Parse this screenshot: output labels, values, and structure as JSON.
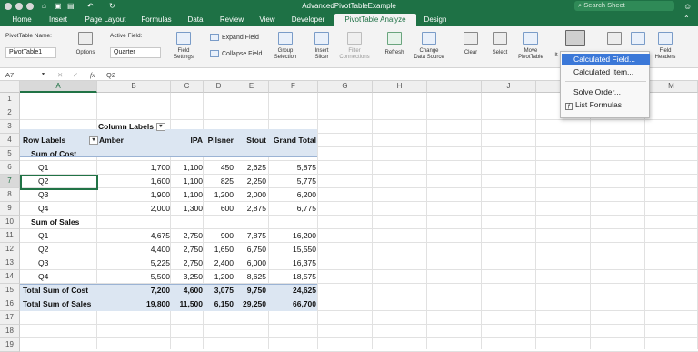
{
  "window": {
    "title": "AdvancedPivotTableExample",
    "search_placeholder": "Search Sheet"
  },
  "tabs": [
    "Home",
    "Insert",
    "Page Layout",
    "Formulas",
    "Data",
    "Review",
    "View",
    "Developer",
    "PivotTable Analyze",
    "Design"
  ],
  "ribbon": {
    "pivot_name_label": "PivotTable Name:",
    "pivot_name_value": "PivotTable1",
    "options": "Options",
    "active_field_label": "Active Field:",
    "active_field_value": "Quarter",
    "field_settings": [
      "Field",
      "Settings"
    ],
    "expand_field": "Expand Field",
    "collapse_field": "Collapse Field",
    "group_selection": [
      "Group",
      "Selection"
    ],
    "insert_slicer": [
      "Insert",
      "Slicer"
    ],
    "filter_connections": [
      "Filter",
      "Connections"
    ],
    "refresh": "Refresh",
    "change_data_source": [
      "Change",
      "Data Source"
    ],
    "clear": "Clear",
    "select": "Select",
    "move_pivottable": [
      "Move",
      "PivotTable"
    ],
    "fields_items_sets_partial": "It",
    "field_headers": [
      "Field",
      "Headers"
    ]
  },
  "formula_bar": {
    "name_box": "A7",
    "fx": "fx",
    "content": "Q2"
  },
  "menu": {
    "items": [
      "Calculated Field...",
      "Calculated Item...",
      "Solve Order...",
      "List Formulas"
    ]
  },
  "sheet": {
    "columns": [
      "A",
      "B",
      "C",
      "D",
      "E",
      "F",
      "G",
      "H",
      "I",
      "J",
      "K",
      "L",
      "M"
    ],
    "rows": [
      "1",
      "2",
      "3",
      "4",
      "5",
      "6",
      "7",
      "8",
      "9",
      "10",
      "11",
      "12",
      "13",
      "14",
      "15",
      "16",
      "17",
      "18",
      "19"
    ],
    "pivot": {
      "column_labels": "Column Labels",
      "row_labels": "Row Labels",
      "headers": [
        "Amber",
        "IPA",
        "Pilsner",
        "Stout",
        "Grand Total"
      ],
      "rows": [
        {
          "label": "Sum of Cost",
          "values": [
            "",
            "",
            "",
            "",
            ""
          ]
        },
        {
          "label": "Q1",
          "values": [
            "1,700",
            "1,100",
            "450",
            "2,625",
            "5,875"
          ]
        },
        {
          "label": "Q2",
          "values": [
            "1,600",
            "1,100",
            "825",
            "2,250",
            "5,775"
          ]
        },
        {
          "label": "Q3",
          "values": [
            "1,900",
            "1,100",
            "1,200",
            "2,000",
            "6,200"
          ]
        },
        {
          "label": "Q4",
          "values": [
            "2,000",
            "1,300",
            "600",
            "2,875",
            "6,775"
          ]
        },
        {
          "label": "Sum of Sales",
          "values": [
            "",
            "",
            "",
            "",
            ""
          ]
        },
        {
          "label": "Q1",
          "values": [
            "4,675",
            "2,750",
            "900",
            "7,875",
            "16,200"
          ]
        },
        {
          "label": "Q2",
          "values": [
            "4,400",
            "2,750",
            "1,650",
            "6,750",
            "15,550"
          ]
        },
        {
          "label": "Q3",
          "values": [
            "5,225",
            "2,750",
            "2,400",
            "6,000",
            "16,375"
          ]
        },
        {
          "label": "Q4",
          "values": [
            "5,500",
            "3,250",
            "1,200",
            "8,625",
            "18,575"
          ]
        },
        {
          "label": "Total Sum of Cost",
          "values": [
            "7,200",
            "4,600",
            "3,075",
            "9,750",
            "24,625"
          ]
        },
        {
          "label": "Total Sum of Sales",
          "values": [
            "19,800",
            "11,500",
            "6,150",
            "29,250",
            "66,700"
          ]
        }
      ]
    }
  },
  "colors": {
    "excel_green": "#1e7145",
    "pivot_band": "#dce6f2",
    "menu_highlight": "#3b78d8"
  }
}
